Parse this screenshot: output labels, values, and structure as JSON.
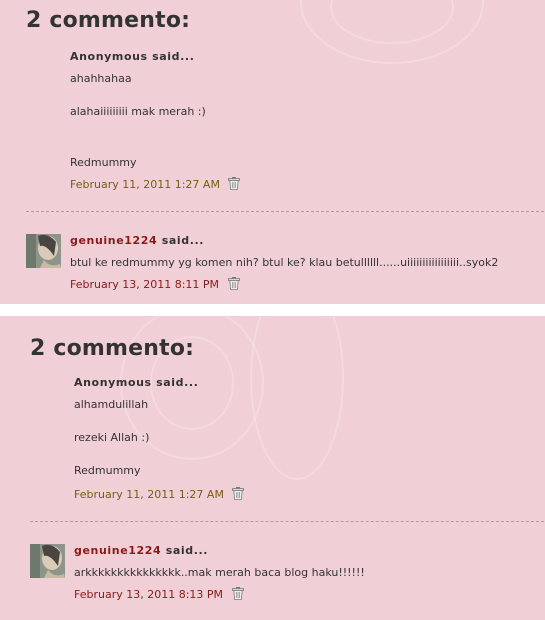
{
  "panels": [
    {
      "heading": "2 commento:",
      "comments": [
        {
          "author": "Anonymous",
          "said": "said...",
          "lines": [
            "ahahhahaa",
            "alahaiiiiiiiii mak merah :)",
            "Redmummy"
          ],
          "date": "February 11, 2011 1:27 AM"
        },
        {
          "author": "genuine1224",
          "said": "said...",
          "lines": [
            "btul ke redmummy yg komen nih? btul ke? klau betullllll......uiiiiiiiiiiiiiiiii..syok2"
          ],
          "date": "February 13, 2011 8:11 PM"
        }
      ]
    },
    {
      "heading": "2 commento:",
      "comments": [
        {
          "author": "Anonymous",
          "said": "said...",
          "lines": [
            "alhamdulillah",
            "rezeki Allah :)",
            "Redmummy"
          ],
          "date": "February 11, 2011 1:27 AM"
        },
        {
          "author": "genuine1224",
          "said": "said...",
          "lines": [
            "arkkkkkkkkkkkkkkk..mak merah baca blog haku!!!!!!"
          ],
          "date": "February 13, 2011 8:13 PM"
        }
      ]
    }
  ],
  "icons": {
    "delete": "trash-icon"
  },
  "colors": {
    "panel_bg": "#f1cfd6",
    "author_link": "#8b1a1a",
    "date_olive": "#7a5c10"
  }
}
